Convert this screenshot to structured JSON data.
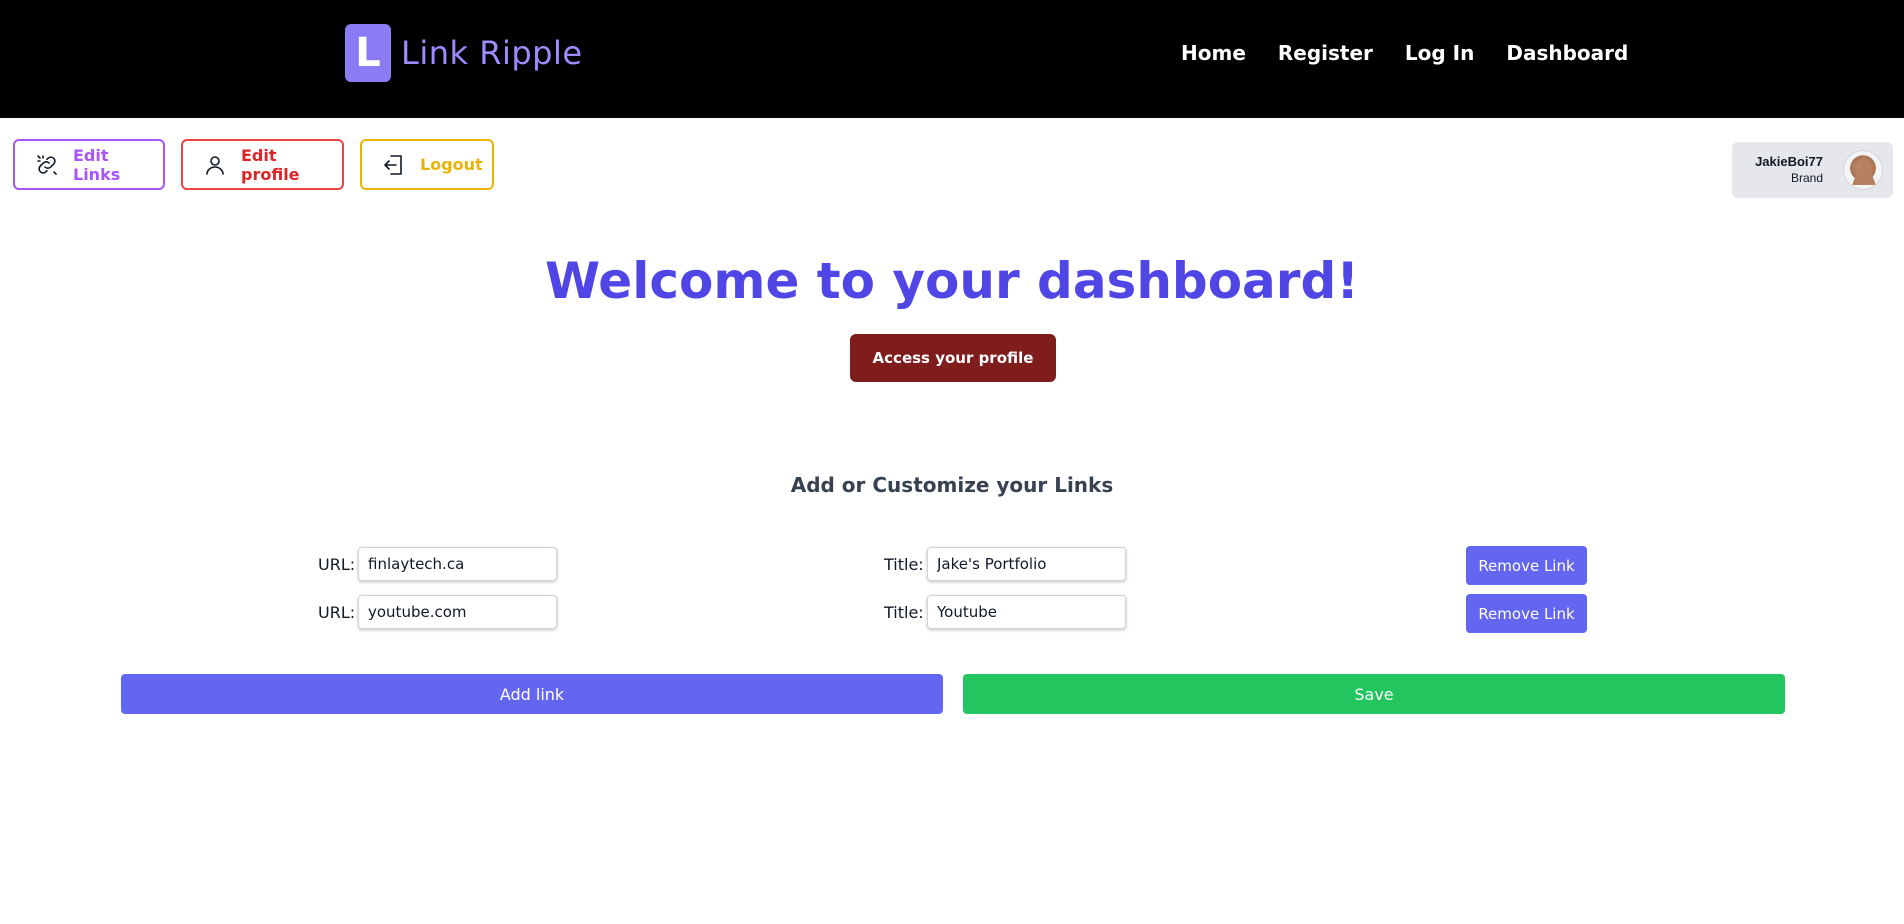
{
  "brand": {
    "logo_letter": "L",
    "name": "Link Ripple",
    "logo_color": "#8b7cf6"
  },
  "nav": {
    "items": [
      {
        "label": "Home"
      },
      {
        "label": "Register"
      },
      {
        "label": "Log In"
      },
      {
        "label": "Dashboard"
      }
    ]
  },
  "actions": {
    "edit_links": {
      "label": "Edit Links",
      "icon": "link-icon",
      "color": "#a855f7"
    },
    "edit_profile": {
      "label": "Edit profile",
      "icon": "user-icon",
      "color": "#ef4444"
    },
    "logout": {
      "label": "Logout",
      "icon": "logout-icon",
      "color": "#eab308"
    }
  },
  "user": {
    "username": "JakieBoi77",
    "role": "Brand"
  },
  "main": {
    "welcome": "Welcome to your dashboard!",
    "access_profile": "Access your profile",
    "section_title": "Add or Customize your Links"
  },
  "links": {
    "url_label": "URL:",
    "title_label": "Title:",
    "remove_label": "Remove Link",
    "rows": [
      {
        "url": "finlaytech.ca",
        "title": "Jake's Portfolio"
      },
      {
        "url": "youtube.com",
        "title": "Youtube"
      }
    ]
  },
  "footer_buttons": {
    "add": "Add link",
    "save": "Save"
  },
  "colors": {
    "accent": "#4f46e5",
    "primary": "#6366f1",
    "success": "#22c55e",
    "profile_btn": "#7f1d1d"
  }
}
